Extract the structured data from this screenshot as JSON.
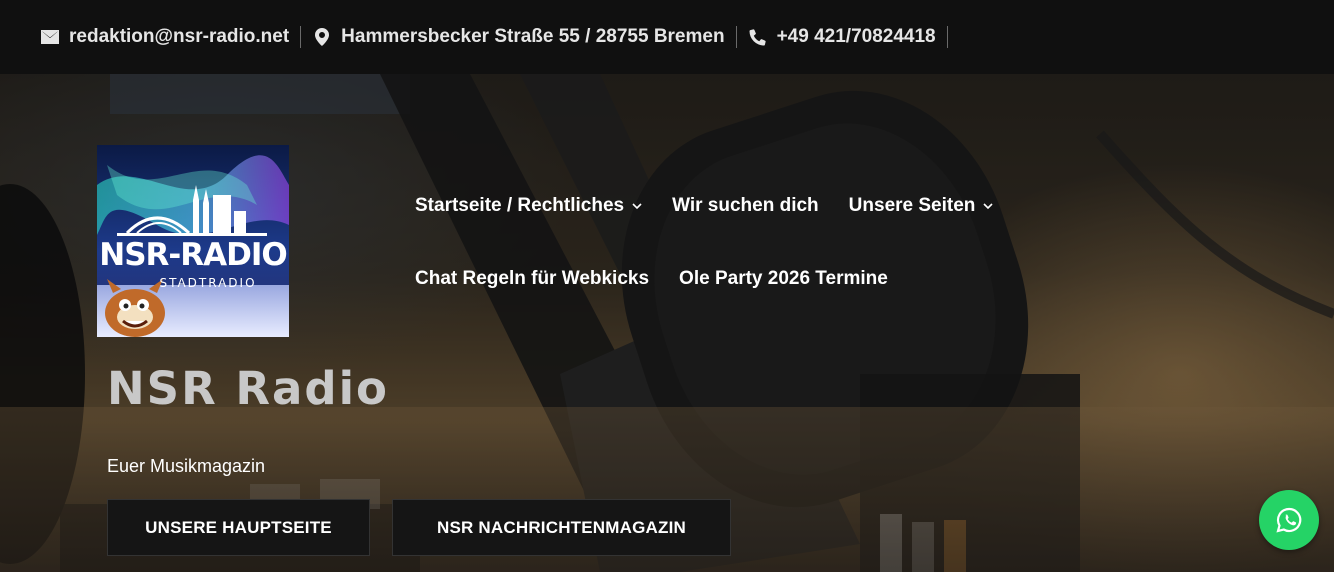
{
  "topbar": {
    "email": "redaktion@nsr-radio.net",
    "address": "Hammersbecker Straße 55 / 28755 Bremen",
    "phone": "+49 421/70824418",
    "icons": [
      "envelope-icon",
      "map-pin-icon",
      "phone-icon"
    ]
  },
  "logo": {
    "title": "NSR-RADIO",
    "subtitle": "STADTRADIO"
  },
  "nav": {
    "row1": [
      {
        "label": "Startseite / Rechtliches",
        "has_dropdown": true
      },
      {
        "label": "Wir suchen dich",
        "has_dropdown": false
      },
      {
        "label": "Unsere Seiten",
        "has_dropdown": true
      }
    ],
    "row2": [
      {
        "label": "Chat Regeln für Webkicks",
        "has_dropdown": false
      },
      {
        "label": "Ole Party 2026 Termine",
        "has_dropdown": false
      }
    ]
  },
  "hero": {
    "title": "NSR Radio",
    "subtitle": "Euer Musikmagazin",
    "buttons": {
      "main": "UNSERE HAUPTSEITE",
      "news": "NSR NACHRICHTENMAGAZIN"
    }
  },
  "colors": {
    "topbar_bg": "#101010",
    "button_bg": "#151515",
    "whatsapp": "#25d366"
  }
}
